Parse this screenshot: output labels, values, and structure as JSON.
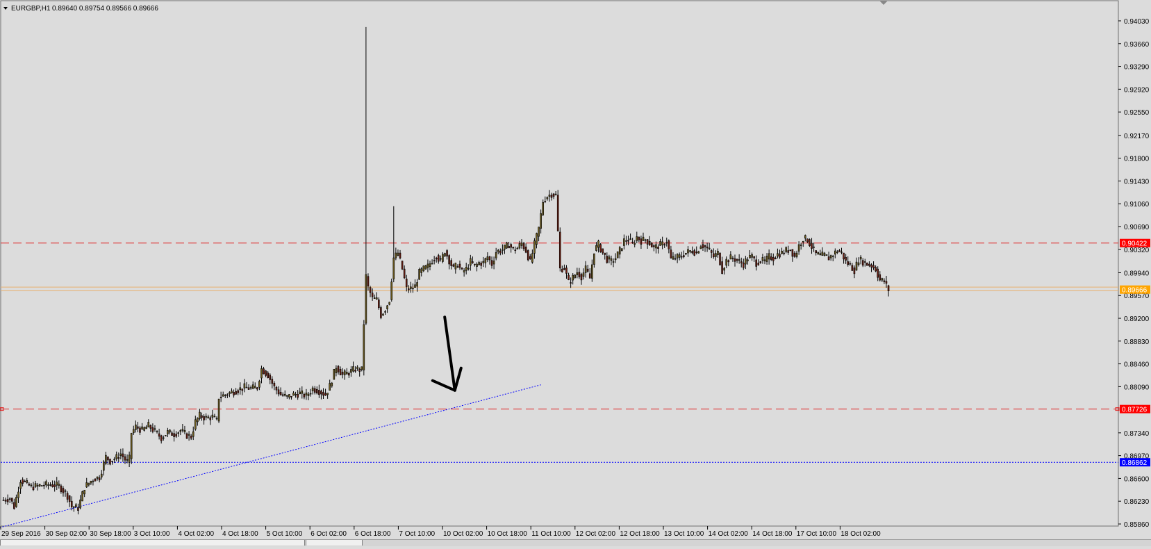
{
  "header": {
    "symbol": "EURGBP,H1",
    "ohlc": "0.89640 0.89754 0.89566 0.89666"
  },
  "chart_data": {
    "type": "candlestick",
    "symbol": "EURGBP",
    "timeframe": "H1",
    "ylim": [
      0.8586,
      0.9403
    ],
    "y_ticks": [
      "0.94030",
      "0.93660",
      "0.93290",
      "0.92920",
      "0.92550",
      "0.92170",
      "0.91800",
      "0.91430",
      "0.91060",
      "0.90690",
      "0.90320",
      "0.89940",
      "0.89570",
      "0.89200",
      "0.88830",
      "0.88460",
      "0.88090",
      "0.87340",
      "0.86970",
      "0.86600",
      "0.86230",
      "0.85860"
    ],
    "x_ticks": [
      "29 Sep 2016",
      "30 Sep 02:00",
      "30 Sep 18:00",
      "3 Oct 10:00",
      "4 Oct 02:00",
      "4 Oct 18:00",
      "5 Oct 10:00",
      "6 Oct 02:00",
      "6 Oct 18:00",
      "7 Oct 10:00",
      "10 Oct 02:00",
      "10 Oct 18:00",
      "11 Oct 10:00",
      "12 Oct 02:00",
      "12 Oct 18:00",
      "13 Oct 10:00",
      "14 Oct 02:00",
      "14 Oct 18:00",
      "17 Oct 10:00",
      "18 Oct 02:00"
    ],
    "price_labels": [
      {
        "value": 0.90422,
        "text": "0.90422",
        "color": "#ff0000"
      },
      {
        "value": 0.89666,
        "text": "0.89666",
        "color": "#ffa500"
      },
      {
        "value": 0.87726,
        "text": "0.87726",
        "color": "#ff0000"
      },
      {
        "value": 0.86862,
        "text": "0.86862",
        "color": "#0000ff"
      }
    ],
    "hlines": [
      {
        "value": 0.90422,
        "style": "dashed",
        "color": "#e02020"
      },
      {
        "value": 0.89706,
        "style": "solid",
        "color": "#e8b070"
      },
      {
        "value": 0.89646,
        "style": "solid",
        "color": "#e8b070"
      },
      {
        "value": 0.87726,
        "style": "dashed",
        "color": "#e02020"
      },
      {
        "value": 0.86862,
        "style": "dotted",
        "color": "#0000ff"
      }
    ],
    "trendline": {
      "from": {
        "bar": -3,
        "price": 0.8579
      },
      "to": {
        "bar": 252,
        "price": 0.8812
      },
      "color": "#0000ff",
      "style": "dotted"
    },
    "arrow": {
      "from": {
        "bar": 203,
        "price": 0.8922
      },
      "to": {
        "bar": 211,
        "price": 0.8803
      },
      "color": "#000000"
    },
    "ohlc_path": [
      [
        0,
        0.8625
      ],
      [
        3,
        0.8628
      ],
      [
        5,
        0.8614
      ],
      [
        8,
        0.8658
      ],
      [
        13,
        0.8646
      ],
      [
        18,
        0.8649
      ],
      [
        22,
        0.865
      ],
      [
        26,
        0.8648
      ],
      [
        30,
        0.8632
      ],
      [
        32,
        0.8614
      ],
      [
        35,
        0.8612
      ],
      [
        38,
        0.8646
      ],
      [
        42,
        0.8659
      ],
      [
        45,
        0.8662
      ],
      [
        48,
        0.8695
      ],
      [
        50,
        0.8688
      ],
      [
        53,
        0.8694
      ],
      [
        55,
        0.87
      ],
      [
        58,
        0.8686
      ],
      [
        59,
        0.8692
      ],
      [
        60,
        0.8734
      ],
      [
        62,
        0.8744
      ],
      [
        65,
        0.8738
      ],
      [
        68,
        0.8746
      ],
      [
        71,
        0.8736
      ],
      [
        74,
        0.8726
      ],
      [
        77,
        0.8735
      ],
      [
        80,
        0.8732
      ],
      [
        83,
        0.8738
      ],
      [
        86,
        0.873
      ],
      [
        88,
        0.8728
      ],
      [
        90,
        0.8752
      ],
      [
        92,
        0.8762
      ],
      [
        95,
        0.8758
      ],
      [
        98,
        0.876
      ],
      [
        100,
        0.8753
      ],
      [
        101,
        0.8792
      ],
      [
        104,
        0.8796
      ],
      [
        107,
        0.88
      ],
      [
        110,
        0.8804
      ],
      [
        113,
        0.8808
      ],
      [
        116,
        0.8806
      ],
      [
        119,
        0.8808
      ],
      [
        121,
        0.8838
      ],
      [
        124,
        0.8828
      ],
      [
        127,
        0.8808
      ],
      [
        130,
        0.8796
      ],
      [
        133,
        0.8792
      ],
      [
        136,
        0.8796
      ],
      [
        139,
        0.8798
      ],
      [
        142,
        0.8794
      ],
      [
        145,
        0.8806
      ],
      [
        148,
        0.8802
      ],
      [
        151,
        0.8796
      ],
      [
        153,
        0.881
      ],
      [
        156,
        0.8842
      ],
      [
        159,
        0.8828
      ],
      [
        162,
        0.8832
      ],
      [
        165,
        0.8838
      ],
      [
        168,
        0.8836
      ],
      [
        170,
        0.8988
      ],
      [
        171,
        0.897
      ],
      [
        173,
        0.8952
      ],
      [
        175,
        0.895
      ],
      [
        177,
        0.8925
      ],
      [
        179,
        0.8935
      ],
      [
        181,
        0.895
      ],
      [
        183,
        0.9018
      ],
      [
        185,
        0.9026
      ],
      [
        187,
        0.9
      ],
      [
        189,
        0.8968
      ],
      [
        191,
        0.8968
      ],
      [
        193,
        0.8972
      ],
      [
        195,
        0.8994
      ],
      [
        197,
        0.9
      ],
      [
        199,
        0.9004
      ],
      [
        201,
        0.9014
      ],
      [
        203,
        0.9022
      ],
      [
        205,
        0.9012
      ],
      [
        207,
        0.903
      ],
      [
        209,
        0.9014
      ],
      [
        211,
        0.9
      ],
      [
        213,
        0.9008
      ],
      [
        215,
        0.8995
      ],
      [
        217,
        0.9
      ],
      [
        219,
        0.9012
      ],
      [
        221,
        0.9004
      ],
      [
        223,
        0.901
      ],
      [
        225,
        0.901
      ],
      [
        227,
        0.902
      ],
      [
        229,
        0.9008
      ],
      [
        231,
        0.9028
      ],
      [
        233,
        0.903
      ],
      [
        235,
        0.9034
      ],
      [
        237,
        0.904
      ],
      [
        239,
        0.9031
      ],
      [
        241,
        0.9034
      ],
      [
        243,
        0.9042
      ],
      [
        245,
        0.903
      ],
      [
        247,
        0.9011
      ],
      [
        249,
        0.904
      ],
      [
        251,
        0.9066
      ],
      [
        253,
        0.911
      ],
      [
        255,
        0.9118
      ],
      [
        257,
        0.9122
      ],
      [
        259,
        0.912
      ],
      [
        261,
        0.9
      ],
      [
        263,
        0.9002
      ],
      [
        265,
        0.8978
      ],
      [
        267,
        0.8986
      ],
      [
        269,
        0.8995
      ],
      [
        271,
        0.8988
      ],
      [
        273,
        0.9
      ],
      [
        275,
        0.8985
      ],
      [
        277,
        0.903
      ],
      [
        279,
        0.904
      ],
      [
        281,
        0.9026
      ],
      [
        283,
        0.9016
      ],
      [
        285,
        0.9012
      ],
      [
        287,
        0.9018
      ],
      [
        289,
        0.903
      ],
      [
        291,
        0.9046
      ],
      [
        293,
        0.9048
      ],
      [
        295,
        0.904
      ],
      [
        297,
        0.9052
      ],
      [
        299,
        0.9046
      ],
      [
        301,
        0.9048
      ],
      [
        303,
        0.9042
      ],
      [
        305,
        0.9034
      ],
      [
        307,
        0.9038
      ],
      [
        309,
        0.904
      ],
      [
        311,
        0.9046
      ],
      [
        313,
        0.9016
      ],
      [
        315,
        0.9018
      ],
      [
        317,
        0.902
      ],
      [
        319,
        0.9024
      ],
      [
        321,
        0.9028
      ],
      [
        323,
        0.903
      ],
      [
        325,
        0.9026
      ],
      [
        327,
        0.904
      ],
      [
        329,
        0.9036
      ],
      [
        331,
        0.903
      ],
      [
        333,
        0.902
      ],
      [
        335,
        0.9026
      ],
      [
        337,
        0.8998
      ],
      [
        339,
        0.9014
      ],
      [
        341,
        0.9018
      ],
      [
        343,
        0.9016
      ],
      [
        345,
        0.9012
      ],
      [
        347,
        0.9008
      ],
      [
        349,
        0.9018
      ],
      [
        351,
        0.902
      ],
      [
        353,
        0.901
      ],
      [
        355,
        0.9014
      ],
      [
        357,
        0.9012
      ],
      [
        359,
        0.902
      ],
      [
        361,
        0.9018
      ],
      [
        363,
        0.9024
      ],
      [
        365,
        0.9026
      ],
      [
        367,
        0.903
      ],
      [
        369,
        0.9032
      ],
      [
        371,
        0.902
      ],
      [
        373,
        0.9038
      ],
      [
        375,
        0.905
      ],
      [
        377,
        0.9048
      ],
      [
        379,
        0.9036
      ],
      [
        381,
        0.9024
      ],
      [
        383,
        0.9022
      ],
      [
        385,
        0.9022
      ],
      [
        387,
        0.9018
      ],
      [
        389,
        0.9024
      ],
      [
        391,
        0.903
      ],
      [
        393,
        0.9026
      ],
      [
        395,
        0.9012
      ],
      [
        397,
        0.9006
      ],
      [
        399,
        0.8998
      ],
      [
        401,
        0.9016
      ],
      [
        403,
        0.9012
      ],
      [
        405,
        0.9008
      ],
      [
        407,
        0.9006
      ],
      [
        409,
        0.9
      ],
      [
        411,
        0.8982
      ],
      [
        413,
        0.898
      ],
      [
        415,
        0.8966
      ]
    ],
    "spike": {
      "bar": 170,
      "high": 0.9393,
      "low": 0.8838
    },
    "spike2": {
      "bar": 183,
      "high": 0.9102
    }
  }
}
